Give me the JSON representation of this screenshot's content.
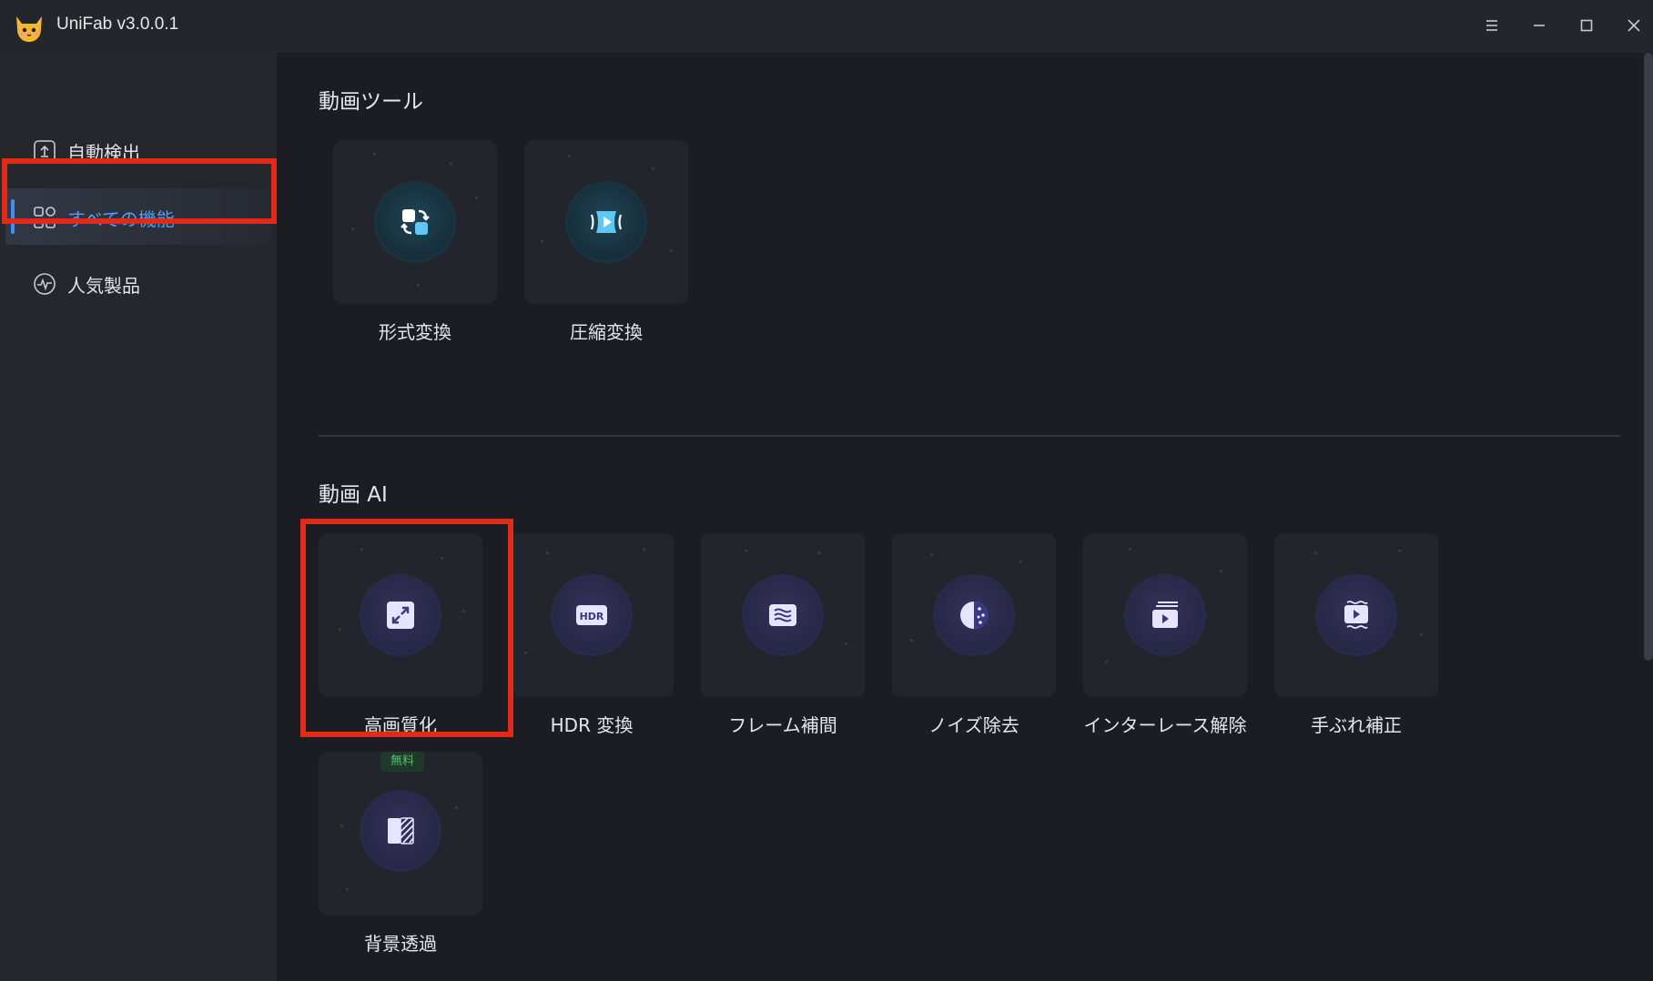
{
  "app": {
    "title": "UniFab v3.0.0.1"
  },
  "window_controls": {
    "menu_icon": "hamburger-icon",
    "minimize_icon": "minimize-icon",
    "maximize_icon": "maximize-icon",
    "close_icon": "close-icon"
  },
  "sidebar": {
    "items": [
      {
        "label": "自動検出",
        "icon": "upload-box-icon",
        "active": false
      },
      {
        "label": "すべての機能",
        "icon": "grid-icon",
        "active": true
      },
      {
        "label": "人気製品",
        "icon": "pulse-circle-icon",
        "active": false
      }
    ]
  },
  "sections": {
    "video_tools": {
      "title": "動画ツール",
      "tiles": [
        {
          "label": "形式変換",
          "icon": "format-convert-icon"
        },
        {
          "label": "圧縮変換",
          "icon": "compress-icon"
        }
      ]
    },
    "video_ai": {
      "title": "動画 AI",
      "tiles": [
        {
          "label": "高画質化",
          "icon": "upscale-icon"
        },
        {
          "label": "HDR 変換",
          "icon": "hdr-icon",
          "icon_text": "HDR"
        },
        {
          "label": "フレーム補間",
          "icon": "frame-interpolation-icon"
        },
        {
          "label": "ノイズ除去",
          "icon": "denoise-icon"
        },
        {
          "label": "インターレース解除",
          "icon": "deinterlace-icon"
        },
        {
          "label": "手ぶれ補正",
          "icon": "stabilize-icon"
        },
        {
          "label": "背景透過",
          "icon": "background-remove-icon",
          "badge": "無料"
        }
      ]
    }
  },
  "colors": {
    "accent": "#3b8fff",
    "highlight": "#e12a18",
    "badge_green": "#54c06e"
  }
}
